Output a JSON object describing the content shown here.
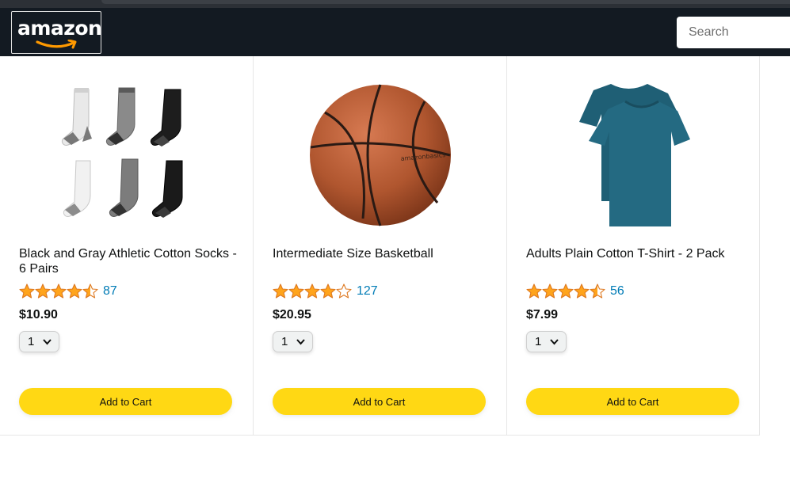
{
  "header": {
    "logo_text": "amazon",
    "search_placeholder": "Search"
  },
  "colors": {
    "header_bg": "#131a22",
    "star": "#ffa41c",
    "link": "#017cb6",
    "cart_button": "#ffd814"
  },
  "products": [
    {
      "name": "Black and Gray Athletic Cotton Socks - 6 Pairs",
      "rating_stars": 4.5,
      "rating_count": "87",
      "price": "$10.90",
      "quantity": "1",
      "button_label": "Add to Cart",
      "image": "socks-image"
    },
    {
      "name": "Intermediate Size Basketball",
      "rating_stars": 4,
      "rating_count": "127",
      "price": "$20.95",
      "quantity": "1",
      "button_label": "Add to Cart",
      "image": "basketball-image"
    },
    {
      "name": "Adults Plain Cotton T-Shirt - 2 Pack",
      "rating_stars": 4.5,
      "rating_count": "56",
      "price": "$7.99",
      "quantity": "1",
      "button_label": "Add to Cart",
      "image": "tshirt-image"
    }
  ]
}
